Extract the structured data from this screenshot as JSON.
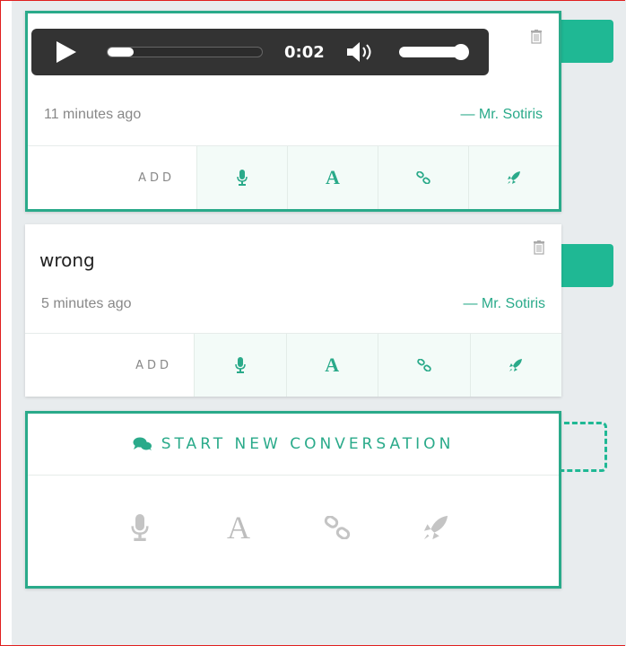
{
  "colors": {
    "accent": "#2aaa8a",
    "tab": "#1fb894",
    "player_bg": "#333333",
    "muted_text": "#888888",
    "frame_border": "#e01f1f"
  },
  "messages": [
    {
      "type": "audio",
      "time_ago": "11 minutes ago",
      "author": "— Mr. Sotiris",
      "player": {
        "elapsed": "0:02",
        "progress": 0.1,
        "volume": 0.9
      },
      "toolbar": {
        "add_label": "ADD",
        "tools": [
          {
            "icon": "microphone-icon"
          },
          {
            "icon": "text-icon",
            "glyph": "A"
          },
          {
            "icon": "link-icon"
          },
          {
            "icon": "rocket-icon"
          }
        ]
      }
    },
    {
      "type": "text",
      "content": "wrong",
      "time_ago": "5 minutes ago",
      "author": "— Mr. Sotiris",
      "toolbar": {
        "add_label": "ADD",
        "tools": [
          {
            "icon": "microphone-icon"
          },
          {
            "icon": "text-icon",
            "glyph": "A"
          },
          {
            "icon": "link-icon"
          },
          {
            "icon": "rocket-icon"
          }
        ]
      }
    }
  ],
  "new_conversation": {
    "label": "START NEW CONVERSATION",
    "icon": "chat-bubbles-icon",
    "tools": [
      {
        "icon": "microphone-icon"
      },
      {
        "icon": "text-icon",
        "glyph": "A"
      },
      {
        "icon": "link-icon"
      },
      {
        "icon": "rocket-icon"
      }
    ]
  },
  "icons": {
    "trash": "trash-icon",
    "play": "play-icon",
    "speaker": "speaker-icon"
  }
}
